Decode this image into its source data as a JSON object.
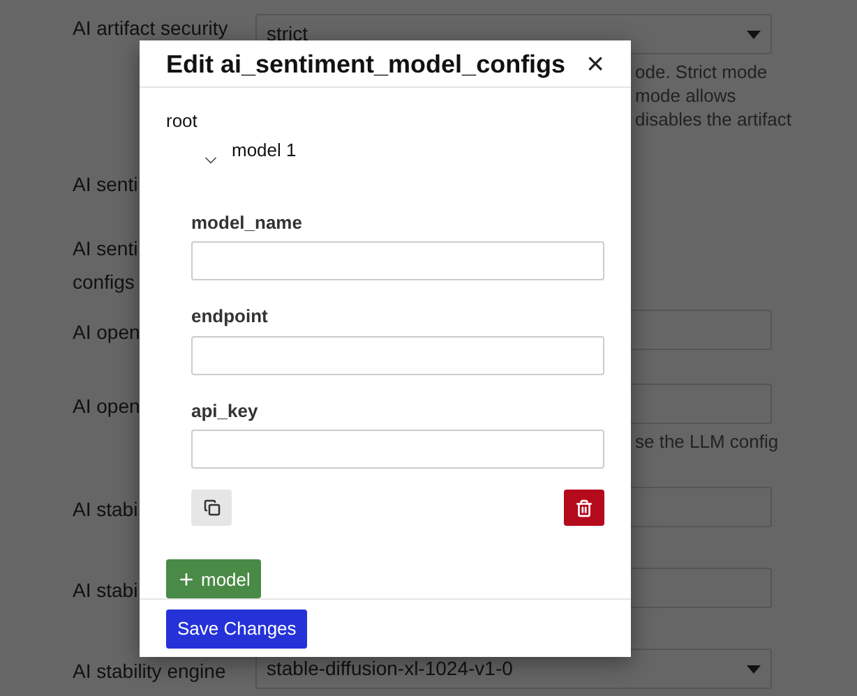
{
  "background_settings": [
    {
      "label_lines": [
        "AI artifact security"
      ],
      "field": {
        "kind": "select",
        "value": "strict"
      },
      "help": [
        "ode. Strict mode",
        "mode allows",
        "disables the artifact"
      ]
    },
    {
      "label_lines": [
        "AI senti"
      ]
    },
    {
      "label_lines": [
        "AI senti",
        "configs"
      ]
    },
    {
      "label_lines": [
        "AI open"
      ],
      "field": {
        "kind": "text"
      }
    },
    {
      "label_lines": [
        "AI open"
      ],
      "field": {
        "kind": "text"
      },
      "help": [
        "se the LLM config"
      ]
    },
    {
      "label_lines": [
        "AI stabi"
      ],
      "field": {
        "kind": "text"
      }
    },
    {
      "label_lines": [
        "AI stabi"
      ],
      "field": {
        "kind": "text"
      }
    },
    {
      "label_lines": [
        "AI stability engine"
      ],
      "field": {
        "kind": "select",
        "value": "stable-diffusion-xl-1024-v1-0"
      }
    }
  ],
  "dialog": {
    "title": "Edit ai_sentiment_model_configs",
    "close": "×",
    "root_label": "root",
    "item": {
      "label": "model 1",
      "expanded": true,
      "fields": [
        {
          "label": "model_name"
        },
        {
          "label": "endpoint"
        },
        {
          "label": "api_key"
        }
      ]
    },
    "add_button": "model",
    "save_button": "Save Changes"
  }
}
